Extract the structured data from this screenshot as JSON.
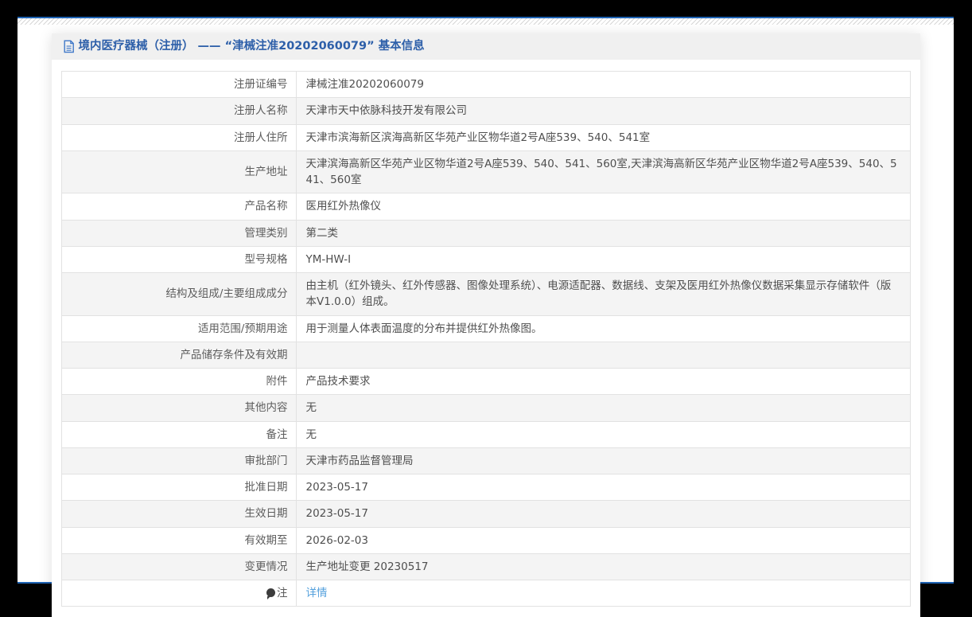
{
  "header": {
    "icon": "document-icon",
    "title": "境内医疗器械（注册） —— “津械注准20202060079” 基本信息"
  },
  "table": {
    "rows": [
      {
        "label": "注册证编号",
        "value": "津械注准20202060079"
      },
      {
        "label": "注册人名称",
        "value": "天津市天中依脉科技开发有限公司"
      },
      {
        "label": "注册人住所",
        "value": "天津市滨海新区滨海高新区华苑产业区物华道2号A座539、540、541室"
      },
      {
        "label": "生产地址",
        "value": "天津滨海高新区华苑产业区物华道2号A座539、540、541、560室,天津滨海高新区华苑产业区物华道2号A座539、540、541、560室"
      },
      {
        "label": "产品名称",
        "value": "医用红外热像仪"
      },
      {
        "label": "管理类别",
        "value": "第二类"
      },
      {
        "label": "型号规格",
        "value": "YM-HW-I"
      },
      {
        "label": "结构及组成/主要组成成分",
        "value": "由主机（红外镜头、红外传感器、图像处理系统）、电源适配器、数据线、支架及医用红外热像仪数据采集显示存储软件（版本V1.0.0）组成。"
      },
      {
        "label": "适用范围/预期用途",
        "value": "用于测量人体表面温度的分布并提供红外热像图。"
      },
      {
        "label": "产品储存条件及有效期",
        "value": ""
      },
      {
        "label": "附件",
        "value": "产品技术要求"
      },
      {
        "label": "其他内容",
        "value": "无"
      },
      {
        "label": "备注",
        "value": "无"
      },
      {
        "label": "审批部门",
        "value": "天津市药品监督管理局"
      },
      {
        "label": "批准日期",
        "value": "2023-05-17"
      },
      {
        "label": "生效日期",
        "value": "2023-05-17"
      },
      {
        "label": "有效期至",
        "value": "2026-02-03"
      },
      {
        "label": "变更情况",
        "value": "生产地址变更 20230517"
      },
      {
        "label": "注",
        "icon": "note-balloon-icon",
        "value": "详情",
        "link": true
      }
    ]
  },
  "colors": {
    "accent_line": "#1e63b4",
    "title_blue": "#2d5fa9",
    "link_blue": "#55a1dd",
    "row_stripe": "#f4f4f4",
    "frame_black": "#000000"
  }
}
